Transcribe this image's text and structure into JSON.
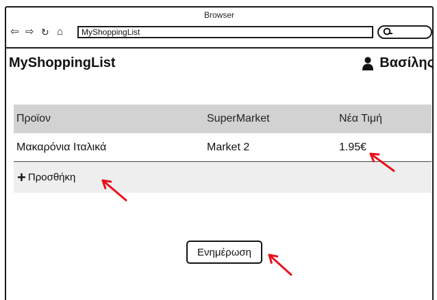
{
  "browser": {
    "title": "Browser",
    "url": "MyShoppingList",
    "icons": [
      "back-arrow-icon",
      "forward-arrow-icon",
      "refresh-icon",
      "home-icon",
      "search-icon"
    ]
  },
  "app": {
    "title": "MyShoppingList",
    "user_name": "Βασίλης",
    "user_icon": "user-icon"
  },
  "table": {
    "columns": [
      "Προϊον",
      "SuperMarket",
      "Νέα Τιμή"
    ],
    "rows": [
      [
        "Μακαρόνια Ιταλικά",
        "Market 2",
        "1.95€"
      ]
    ],
    "header_color": "#d2d2d2",
    "add_row_color": "#eeeeee"
  },
  "actions": {
    "add_label": "Προσθήκη",
    "update_label": "Ενημέρωση"
  },
  "annotation_color": "#e8101a"
}
